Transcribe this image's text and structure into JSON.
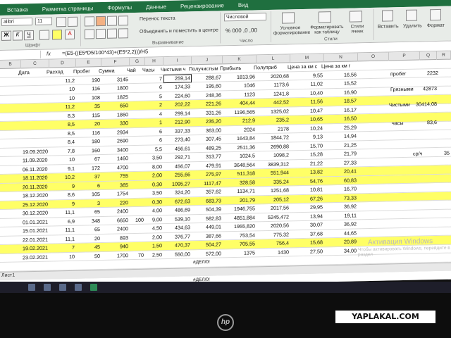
{
  "ribbon": {
    "tabs": [
      "Вставка",
      "Разметка страницы",
      "Формулы",
      "Данные",
      "Рецензирование",
      "Вид"
    ],
    "font_name": "alibri",
    "font_size": "11",
    "wrap_text": "Перенос текста",
    "merge_center": "Объединить и поместить в центре",
    "number_format": "Числовой",
    "cond_format": "Условное форматирование",
    "format_table": "Форматировать как таблицу",
    "cell_styles": "Стили ячеек",
    "insert": "Вставить",
    "delete": "Удалить",
    "format": "Формат",
    "group_font": "Шрифт",
    "group_align": "Выравнивание",
    "group_number": "Число",
    "group_styles": "Стили"
  },
  "formula_bar": {
    "fx": "fx",
    "formula": "=(E5-((E5*D5/100*43)+(E5*2,2)))/H5"
  },
  "columns": [
    "B",
    "C",
    "D",
    "E",
    "F",
    "G",
    "H",
    "I",
    "J",
    "K",
    "L",
    "M",
    "N",
    "O",
    "P",
    "Q",
    "R"
  ],
  "headers": [
    "Дата",
    "Расход",
    "Пробег",
    "Сумма",
    "Чай",
    "Часы",
    "Чистыми ч",
    "Получистым",
    "Прибыль",
    "Полуприб",
    "Цена за км с",
    "Цена за км г"
  ],
  "rows": [
    {
      "hl": false,
      "v": [
        "",
        "11,2",
        "190",
        "3145",
        "",
        "7",
        "259,14",
        "288,67",
        "1813,96",
        "2020,68",
        "9,55",
        "16,56"
      ]
    },
    {
      "hl": false,
      "v": [
        "",
        "10",
        "116",
        "1800",
        "",
        "6",
        "174,33",
        "195,60",
        "1046",
        "1173,6",
        "11,02",
        "15,52"
      ]
    },
    {
      "hl": false,
      "v": [
        "",
        "10",
        "108",
        "1825",
        "",
        "5",
        "224,60",
        "248,36",
        "1123",
        "1241,8",
        "10,40",
        "16,90"
      ]
    },
    {
      "hl": true,
      "v": [
        "",
        "11,2",
        "35",
        "650",
        "",
        "2",
        "202,22",
        "221,26",
        "404,44",
        "442,52",
        "11,56",
        "18,57"
      ]
    },
    {
      "hl": false,
      "v": [
        "",
        "8,3",
        "115",
        "1860",
        "",
        "4",
        "299,14",
        "331,26",
        "1196,565",
        "1325,02",
        "10,47",
        "16,17"
      ]
    },
    {
      "hl": true,
      "v": [
        "",
        "8,5",
        "20",
        "330",
        "",
        "1",
        "212,90",
        "235,20",
        "212,9",
        "235,2",
        "10,65",
        "16,50"
      ]
    },
    {
      "hl": false,
      "v": [
        "",
        "8,5",
        "116",
        "2934",
        "",
        "6",
        "337,33",
        "363,00",
        "2024",
        "2178",
        "10,24",
        "25,29"
      ]
    },
    {
      "hl": false,
      "v": [
        "",
        "8,4",
        "180",
        "2690",
        "",
        "6",
        "273,40",
        "307,45",
        "1643,84",
        "1844,72",
        "9,13",
        "14,94"
      ]
    },
    {
      "hl": false,
      "v": [
        "19.09.2020",
        "7,8",
        "160",
        "3400",
        "",
        "5,5",
        "456,61",
        "489,25",
        "2511,36",
        "2690,88",
        "15,70",
        "21,25"
      ]
    },
    {
      "hl": false,
      "v": [
        "11.09.2020",
        "10",
        "67",
        "1460",
        "",
        "3,50",
        "292,71",
        "313,77",
        "1024,5",
        "1098,2",
        "15,28",
        "21,79"
      ]
    },
    {
      "hl": false,
      "v": [
        "06.11.2020",
        "9,1",
        "172",
        "4700",
        "",
        "8,00",
        "456,07",
        "479,91",
        "3648,564",
        "3839,312",
        "21,22",
        "27,33"
      ]
    },
    {
      "hl": true,
      "v": [
        "18.11.2020",
        "10,2",
        "37",
        "755",
        "",
        "2,00",
        "255,66",
        "275,97",
        "511,318",
        "551,944",
        "13,82",
        "20,41"
      ]
    },
    {
      "hl": true,
      "v": [
        "20.11.2020",
        "9",
        "6",
        "365",
        "",
        "0,30",
        "1095,27",
        "1117,47",
        "328,58",
        "335,24",
        "54,76",
        "60,83"
      ]
    },
    {
      "hl": false,
      "v": [
        "18.12.2020",
        "8,6",
        "105",
        "1754",
        "",
        "3,50",
        "324,20",
        "357,62",
        "1134,71",
        "1251,68",
        "10,81",
        "16,70"
      ]
    },
    {
      "hl": true,
      "v": [
        "25.12.2020",
        "9",
        "3",
        "220",
        "",
        "0,30",
        "672,63",
        "683,73",
        "201,79",
        "205,12",
        "67,26",
        "73,33"
      ]
    },
    {
      "hl": false,
      "v": [
        "30.12.2020",
        "11,1",
        "65",
        "2400",
        "",
        "4,00",
        "486,69",
        "504,39",
        "1946,755",
        "2017,56",
        "29,95",
        "36,92"
      ]
    },
    {
      "hl": false,
      "v": [
        "01.01.2021",
        "6,9",
        "348",
        "6650",
        "100",
        "9,00",
        "539,10",
        "582,83",
        "4851,884",
        "5245,472",
        "13,94",
        "19,11"
      ]
    },
    {
      "hl": false,
      "v": [
        "15.01.2021",
        "11,1",
        "65",
        "2400",
        "",
        "4,50",
        "434,63",
        "449,01",
        "1955,820",
        "2020,56",
        "30,07",
        "36,92"
      ]
    },
    {
      "hl": false,
      "v": [
        "22.01.2021",
        "11,1",
        "20",
        "893",
        "",
        "2,00",
        "376,77",
        "387,66",
        "753,54",
        "775,32",
        "37,68",
        "44,65"
      ]
    },
    {
      "hl": true,
      "v": [
        "19.02.2021",
        "7",
        "45",
        "940",
        "",
        "1,50",
        "470,37",
        "504,27",
        "705,55",
        "756,4",
        "15,68",
        "20,89"
      ]
    },
    {
      "hl": false,
      "v": [
        "23.02.2021",
        "10",
        "50",
        "1700",
        "70",
        "2,50",
        "550,00",
        "572,00",
        "1375",
        "1430",
        "27,50",
        "34,00"
      ]
    },
    {
      "hl": false,
      "v": [
        "",
        "",
        "",
        "",
        "",
        "",
        "",
        "#ДЕЛ/0!",
        "",
        "",
        "",
        ""
      ]
    },
    {
      "hl": false,
      "v": [
        "",
        "",
        "",
        "",
        "",
        "",
        "",
        "#ДЕЛ/0!",
        "",
        "",
        "",
        ""
      ]
    },
    {
      "hl": false,
      "v": [
        "",
        "",
        "",
        "",
        "",
        "",
        "",
        "#ДЕЛ/0!",
        "",
        "",
        "",
        ""
      ]
    }
  ],
  "side": {
    "probeg_label": "пробег",
    "probeg_value": "2232",
    "gryaznymi_label": "Грязными",
    "gryaznymi_value": "42873",
    "chistymi_label": "Чистыми",
    "chistymi_value": "30414,08",
    "chasy_label": "часы",
    "chasy_value": "83,6",
    "rate_label": "ср/ч",
    "rate_value": "35"
  },
  "status": {
    "sheet": "Лист1"
  },
  "watermark": {
    "title": "Активация Windows",
    "sub": "Чтобы активировать Windows, перейдите в раздел"
  },
  "overlay": {
    "site": "YAPLAKAL.COM",
    "brand": "hp"
  },
  "colors": {
    "excel_green": "#1f6f3f",
    "highlight": "#ffff66"
  }
}
